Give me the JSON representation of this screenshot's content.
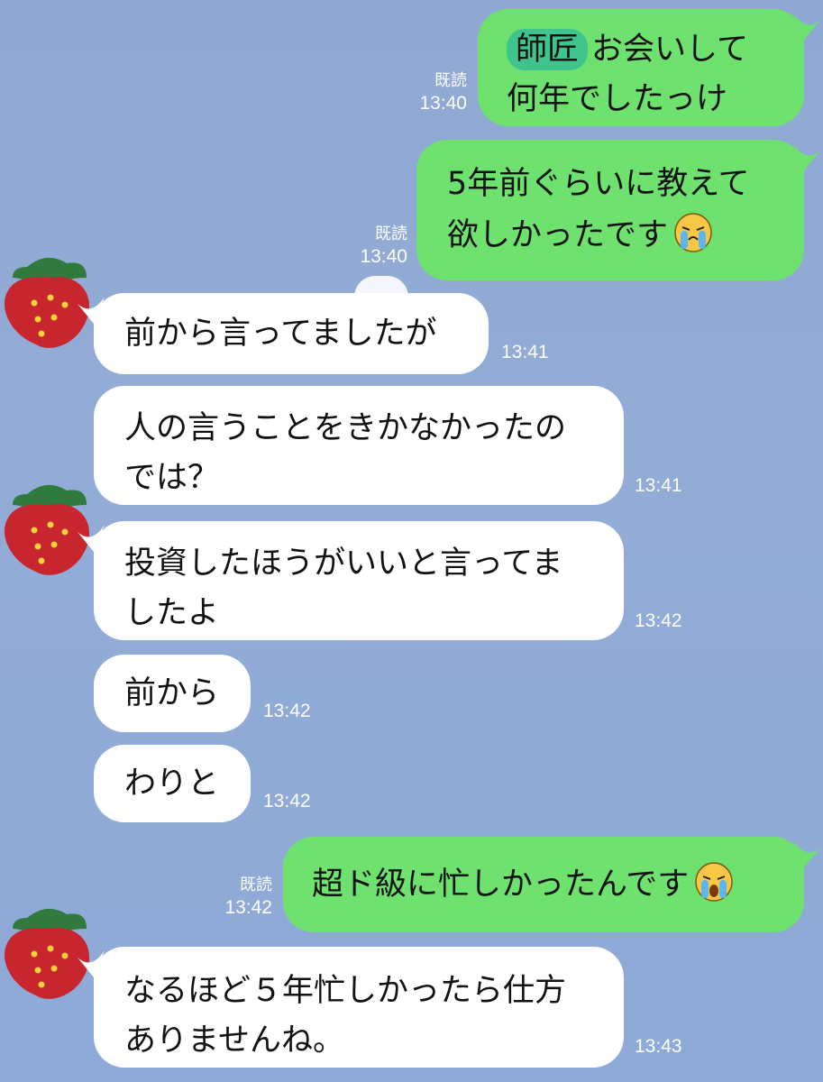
{
  "colors": {
    "background": "#92acd6",
    "sent_bubble": "#6ee16f",
    "received_bubble": "#ffffff",
    "highlight": "#3fc48d"
  },
  "messages": [
    {
      "side": "sent",
      "highlight": "師匠",
      "lines": [
        "お会いして",
        "何年でしたっけ"
      ],
      "read": "既読",
      "time": "13:40"
    },
    {
      "side": "sent",
      "lines": [
        "5年前ぐらいに教えて",
        "欲しかったです"
      ],
      "emoji": "crying-face-icon",
      "read": "既読",
      "time": "13:40"
    },
    {
      "side": "received",
      "lines": [
        "前から言ってましたが"
      ],
      "time": "13:41"
    },
    {
      "side": "received",
      "lines": [
        "人の言うことをきかなかったの",
        "では？"
      ],
      "time": "13:41"
    },
    {
      "side": "received",
      "lines": [
        "投資したほうがいいと言ってま",
        "したよ"
      ],
      "time": "13:42"
    },
    {
      "side": "received",
      "lines": [
        "前から"
      ],
      "time": "13:42"
    },
    {
      "side": "received",
      "lines": [
        "わりと"
      ],
      "time": "13:42"
    },
    {
      "side": "sent",
      "lines": [
        "超ド級に忙しかったんです"
      ],
      "emoji": "crying-face-icon",
      "read": "既読",
      "time": "13:42"
    },
    {
      "side": "received",
      "lines": [
        "なるほど５年忙しかったら仕方",
        "ありませんね。"
      ],
      "time": "13:43"
    }
  ]
}
